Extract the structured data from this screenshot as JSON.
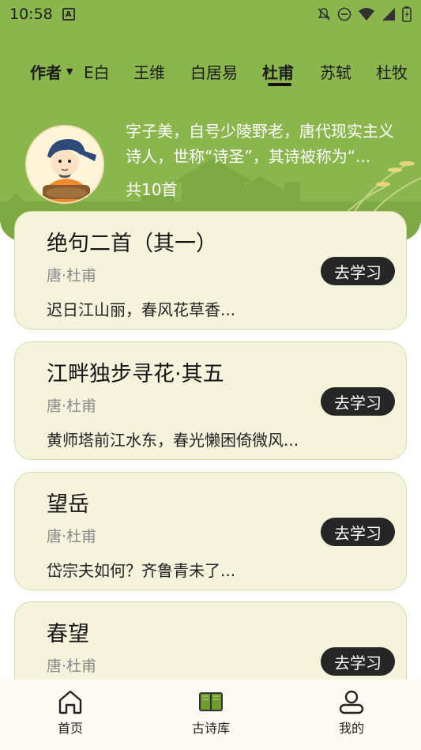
{
  "status_bar": {
    "time": "10:58",
    "icons": [
      "notification-a-icon",
      "bell-off-icon",
      "dnd-icon",
      "wifi-icon",
      "signal-icon",
      "battery-icon"
    ]
  },
  "tabs": {
    "author_dropdown_label": "作者",
    "items": [
      {
        "label": "李白",
        "visible_label": "E白"
      },
      {
        "label": "王维"
      },
      {
        "label": "白居易"
      },
      {
        "label": "杜甫",
        "active": true
      },
      {
        "label": "苏轼"
      },
      {
        "label": "杜牧"
      }
    ]
  },
  "author": {
    "description": "字子美，自号少陵野老，唐代现实主义诗人，世称“诗圣”，其诗被称为“...",
    "count": "共10首"
  },
  "poems": [
    {
      "title": "绝句二首（其一）",
      "meta": "唐·杜甫",
      "excerpt": "迟日江山丽，春风花草香...",
      "button": "去学习"
    },
    {
      "title": "江畔独步寻花·其五",
      "meta": "唐·杜甫",
      "excerpt": "黄师塔前江水东，春光懒困倚微风...",
      "button": "去学习"
    },
    {
      "title": "望岳",
      "meta": "唐·杜甫",
      "excerpt": "岱宗夫如何？齐鲁青未了...",
      "button": "去学习"
    },
    {
      "title": "春望",
      "meta": "唐·杜甫",
      "excerpt": "",
      "button": "去学习"
    }
  ],
  "bottom_nav": {
    "items": [
      {
        "label": "首页",
        "icon": "home-icon"
      },
      {
        "label": "古诗库",
        "icon": "book-icon",
        "active": true
      },
      {
        "label": "我的",
        "icon": "user-icon"
      }
    ]
  },
  "colors": {
    "header_green": "#8bb64d",
    "card_bg": "#f6f3dc",
    "button_dark": "#262626"
  }
}
